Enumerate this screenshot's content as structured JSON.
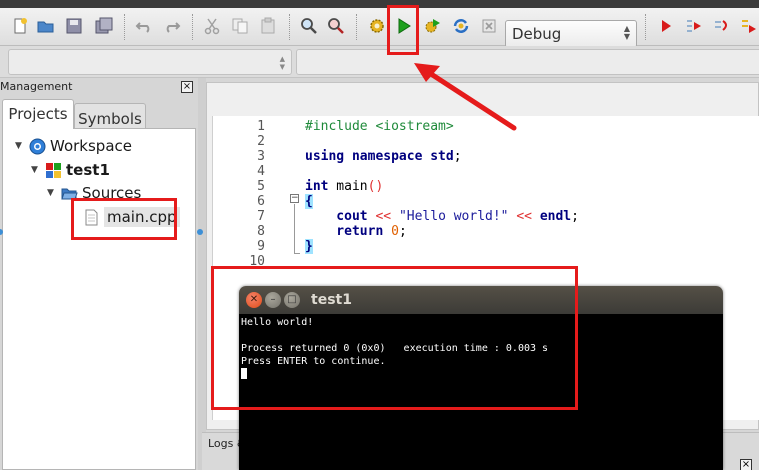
{
  "window": {
    "title": "test1"
  },
  "toolbar": {
    "buttons": [
      "new-file",
      "open",
      "save",
      "save-all",
      "undo",
      "redo",
      "cut",
      "copy",
      "paste",
      "find",
      "replace",
      "build",
      "run",
      "build-and-run",
      "rebuild",
      "abort",
      "debug-start",
      "run-to-cursor",
      "next-line"
    ],
    "build_target": "Debug"
  },
  "management": {
    "title": "Management",
    "close": "×",
    "tabs": [
      {
        "label": "Projects",
        "active": true
      },
      {
        "label": "Symbols",
        "active": false
      }
    ],
    "tree": {
      "workspace": "Workspace",
      "project": "test1",
      "folder": "Sources",
      "file": "main.cpp"
    }
  },
  "editor": {
    "line_numbers": [
      "1",
      "2",
      "3",
      "4",
      "5",
      "6",
      "7",
      "8",
      "9",
      "10"
    ],
    "lines": [
      {
        "n": "1",
        "segments": [
          {
            "t": "#include <iostream>",
            "c": "pp"
          }
        ]
      },
      {
        "n": "2",
        "segments": []
      },
      {
        "n": "3",
        "segments": [
          {
            "t": "using namespace std",
            "c": "kw"
          },
          {
            "t": ";",
            "c": ""
          }
        ]
      },
      {
        "n": "4",
        "segments": []
      },
      {
        "n": "5",
        "segments": [
          {
            "t": "int",
            "c": "kw"
          },
          {
            "t": " main",
            "c": ""
          },
          {
            "t": "()",
            "c": "op"
          }
        ]
      },
      {
        "n": "6",
        "segments": [
          {
            "t": "{",
            "c": "brace"
          }
        ]
      },
      {
        "n": "7",
        "segments": [
          {
            "t": "    cout",
            "c": "kw"
          },
          {
            "t": " << ",
            "c": "op"
          },
          {
            "t": "\"Hello world!\"",
            "c": "str"
          },
          {
            "t": " << ",
            "c": "op"
          },
          {
            "t": "endl",
            "c": "kw"
          },
          {
            "t": ";",
            "c": ""
          }
        ]
      },
      {
        "n": "8",
        "segments": [
          {
            "t": "    return",
            "c": "kw"
          },
          {
            "t": " ",
            "c": ""
          },
          {
            "t": "0",
            "c": "num"
          },
          {
            "t": ";",
            "c": ""
          }
        ]
      },
      {
        "n": "9",
        "segments": [
          {
            "t": "}",
            "c": "brace"
          }
        ]
      },
      {
        "n": "10",
        "segments": []
      }
    ]
  },
  "logs": {
    "title": "Logs &",
    "close": "×"
  },
  "terminal": {
    "title": "test1",
    "output": [
      "Hello world!",
      "",
      "Process returned 0 (0x0)   execution time : 0.003 s",
      "Press ENTER to continue."
    ]
  },
  "colors": {
    "annotation_red": "#e51b1b",
    "run_green": "#1ea01e",
    "terminal_bg": "#000000",
    "selection_highlight": "#9fe3ff"
  }
}
